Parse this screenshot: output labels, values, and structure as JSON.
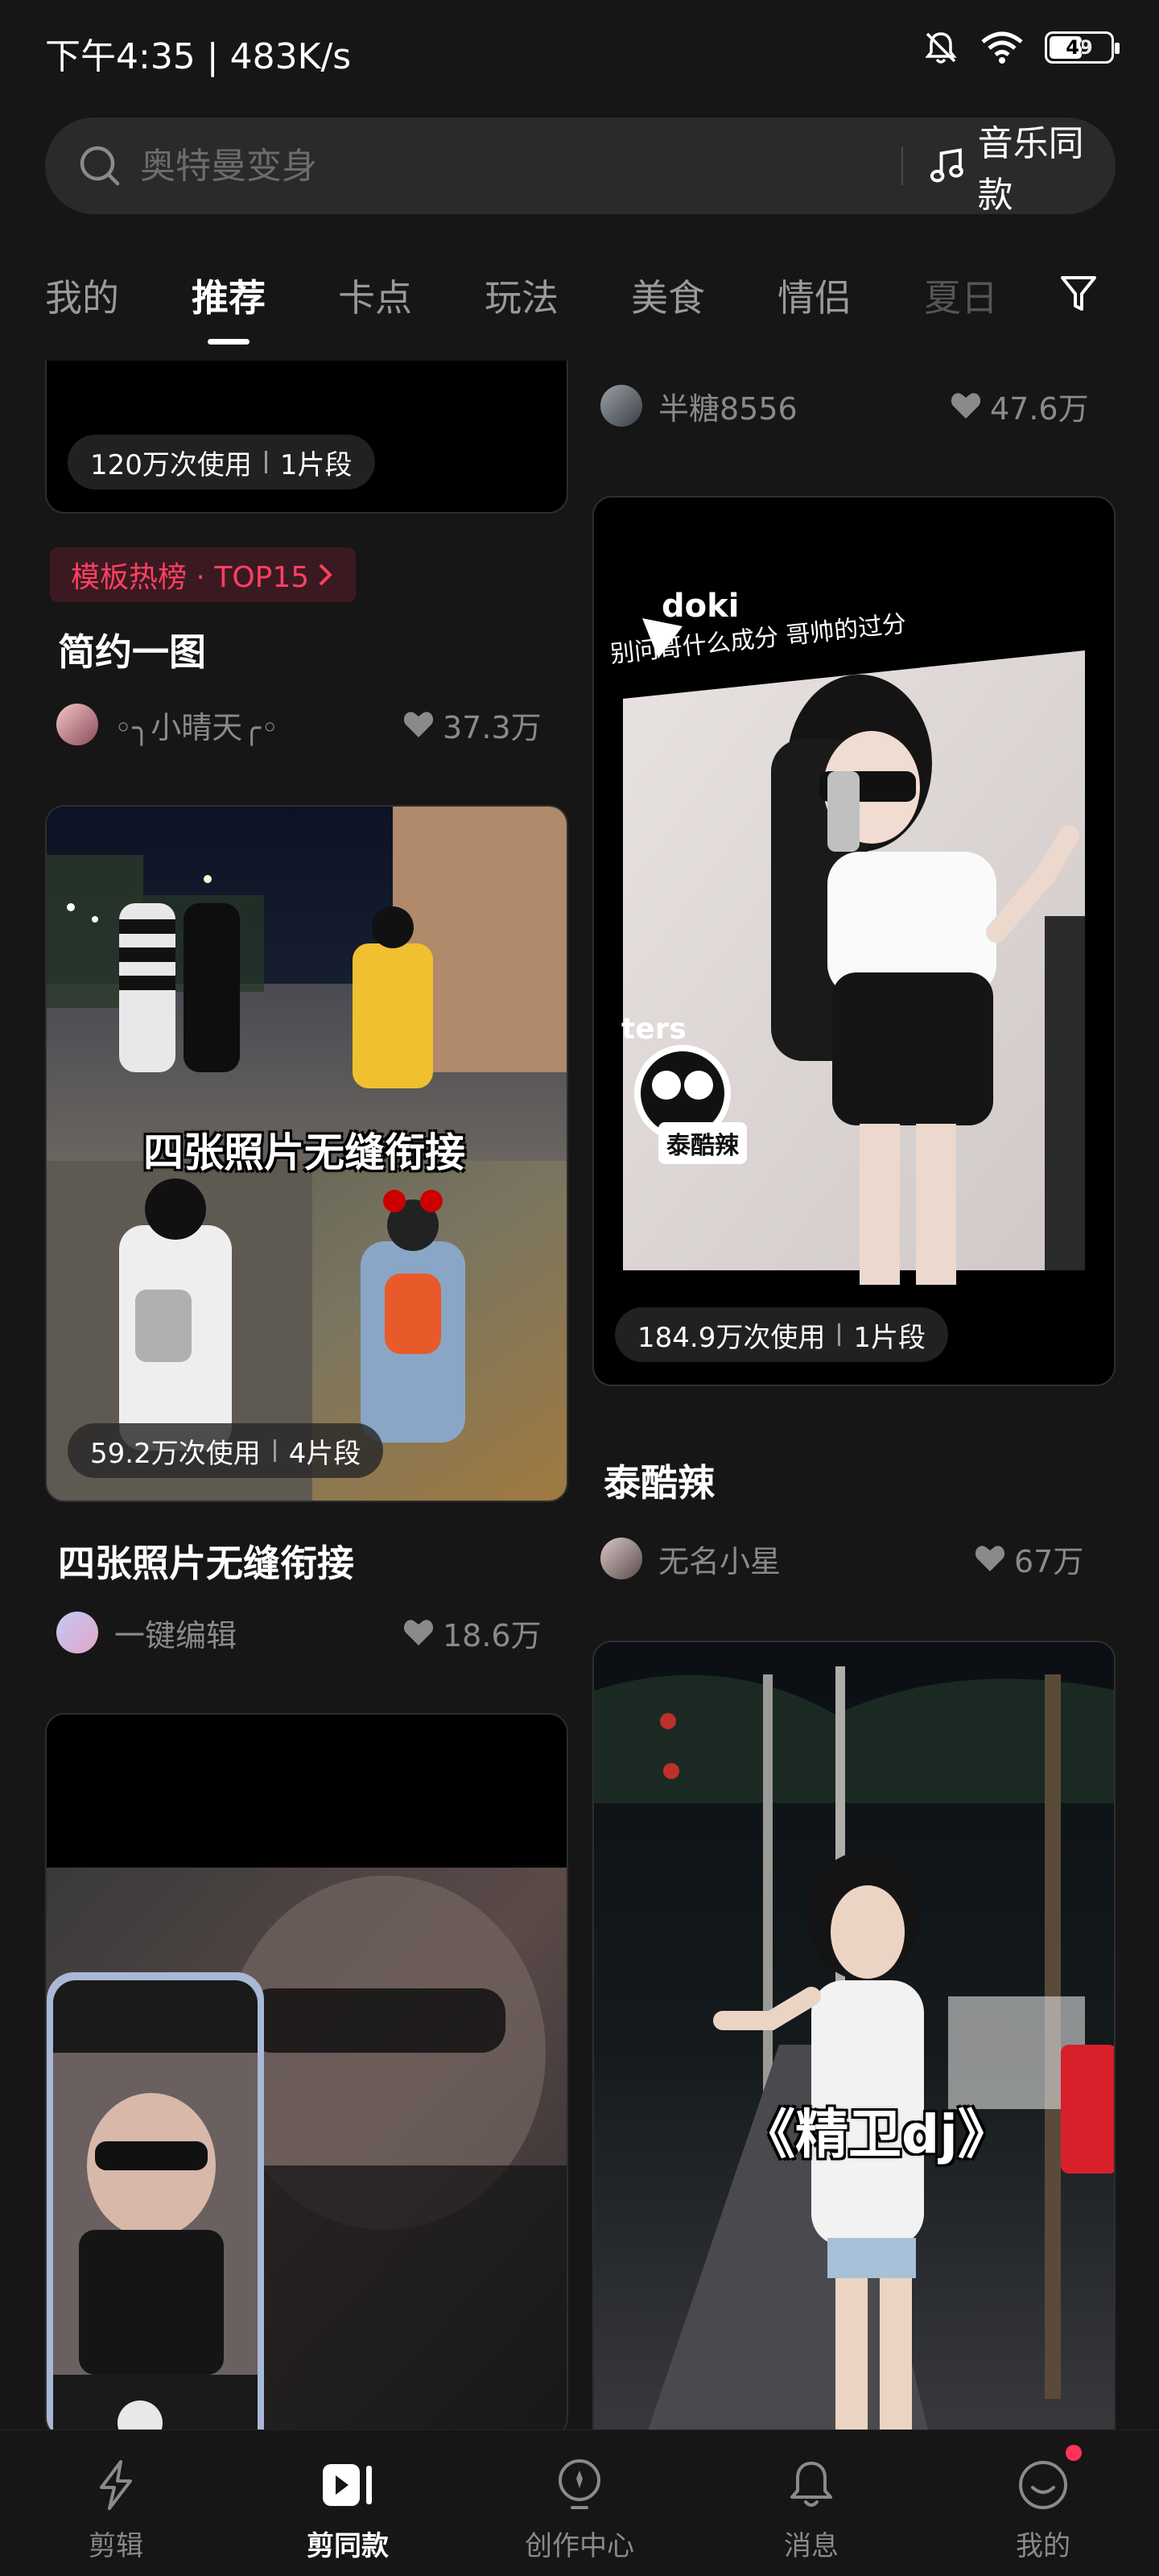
{
  "status_bar": {
    "time": "下午4:35 | 483K/s",
    "battery": "49"
  },
  "search": {
    "placeholder": "奥特曼变身",
    "music_label": "音乐同款"
  },
  "tabs": [
    "我的",
    "推荐",
    "卡点",
    "玩法",
    "美食",
    "情侣",
    "夏日"
  ],
  "active_tab": "推荐",
  "feed": {
    "left": [
      {
        "usage": "120万次使用",
        "segments": "1片段"
      },
      {
        "badge": "模板热榜 · TOP15",
        "title": "简约一图",
        "author": "◦╮小晴天╭◦",
        "likes": "37.3万"
      },
      {
        "overlay": "四张照片无缝衔接",
        "usage": "59.2万次使用",
        "segments": "4片段",
        "title": "四张照片无缝衔接",
        "author": "一键编辑",
        "likes": "18.6万"
      }
    ],
    "right": [
      {
        "author": "半糖8556",
        "likes": "47.6万"
      },
      {
        "doki": "doki",
        "caption": "别问哥什么成分 哥帅的过分",
        "side_text": "ters",
        "sticker": "泰酷辣",
        "usage": "184.9万次使用",
        "segments": "1片段",
        "title": "泰酷辣",
        "author": "无名小星",
        "likes": "67万"
      },
      {
        "overlay": "《精卫dj》"
      }
    ]
  },
  "bottom_nav": [
    {
      "label": "剪辑",
      "icon": "bolt-icon"
    },
    {
      "label": "剪同款",
      "icon": "play-icon"
    },
    {
      "label": "创作中心",
      "icon": "bulb-icon"
    },
    {
      "label": "消息",
      "icon": "bell-icon"
    },
    {
      "label": "我的",
      "icon": "smile-icon"
    }
  ],
  "colors": {
    "background": "#161616",
    "accent": "#ff3f62",
    "card": "#000000",
    "muted": "#8a8a8a"
  }
}
